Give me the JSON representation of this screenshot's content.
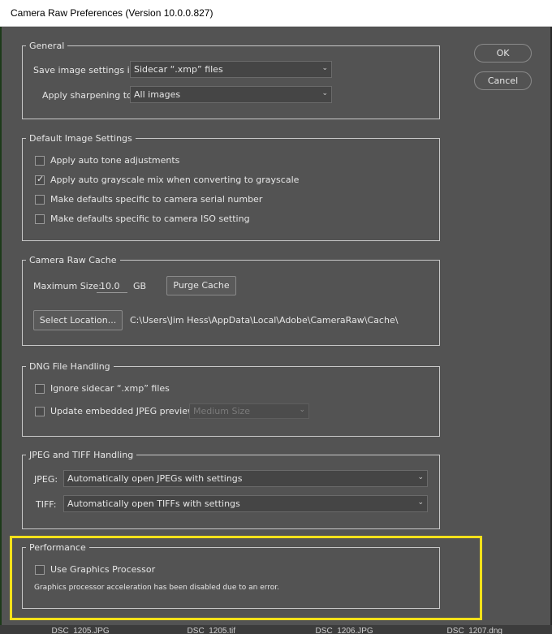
{
  "window": {
    "title": "Camera Raw Preferences  (Version 10.0.0.827)"
  },
  "buttons": {
    "ok": "OK",
    "cancel": "Cancel"
  },
  "general": {
    "legend": "General",
    "save_label": "Save image settings in:",
    "save_value": "Sidecar “.xmp” files",
    "sharpen_label": "Apply sharpening to:",
    "sharpen_value": "All images"
  },
  "default_image": {
    "legend": "Default Image Settings",
    "options": [
      {
        "label": "Apply auto tone adjustments",
        "checked": false
      },
      {
        "label": "Apply auto grayscale mix when converting to grayscale",
        "checked": true
      },
      {
        "label": "Make defaults specific to camera serial number",
        "checked": false
      },
      {
        "label": "Make defaults specific to camera ISO setting",
        "checked": false
      }
    ]
  },
  "cache": {
    "legend": "Camera Raw Cache",
    "max_size_label": "Maximum Size:",
    "max_size_value": "10.0",
    "unit": "GB",
    "purge_label": "Purge Cache",
    "select_location_label": "Select Location...",
    "path": "C:\\Users\\Jim Hess\\AppData\\Local\\Adobe\\CameraRaw\\Cache\\"
  },
  "dng": {
    "legend": "DNG File Handling",
    "ignore_label": "Ignore sidecar “.xmp” files",
    "ignore_checked": false,
    "update_label": "Update embedded JPEG previews:",
    "update_checked": false,
    "preview_value": "Medium Size"
  },
  "jpeg_tiff": {
    "legend": "JPEG and TIFF Handling",
    "jpeg_label": "JPEG:",
    "jpeg_value": "Automatically open JPEGs with settings",
    "tiff_label": "TIFF:",
    "tiff_value": "Automatically open TIFFs with settings"
  },
  "performance": {
    "legend": "Performance",
    "gpu_label": "Use Graphics Processor",
    "gpu_checked": false,
    "note": "Graphics processor acceleration has been disabled due to an error.",
    "highlight_color": "#f3e11a"
  },
  "filmstrip": [
    "_DSC_1205.JPG",
    "_DSC_1205.tif",
    "_DSC_1206.JPG",
    "_DSC_1207.dng"
  ]
}
